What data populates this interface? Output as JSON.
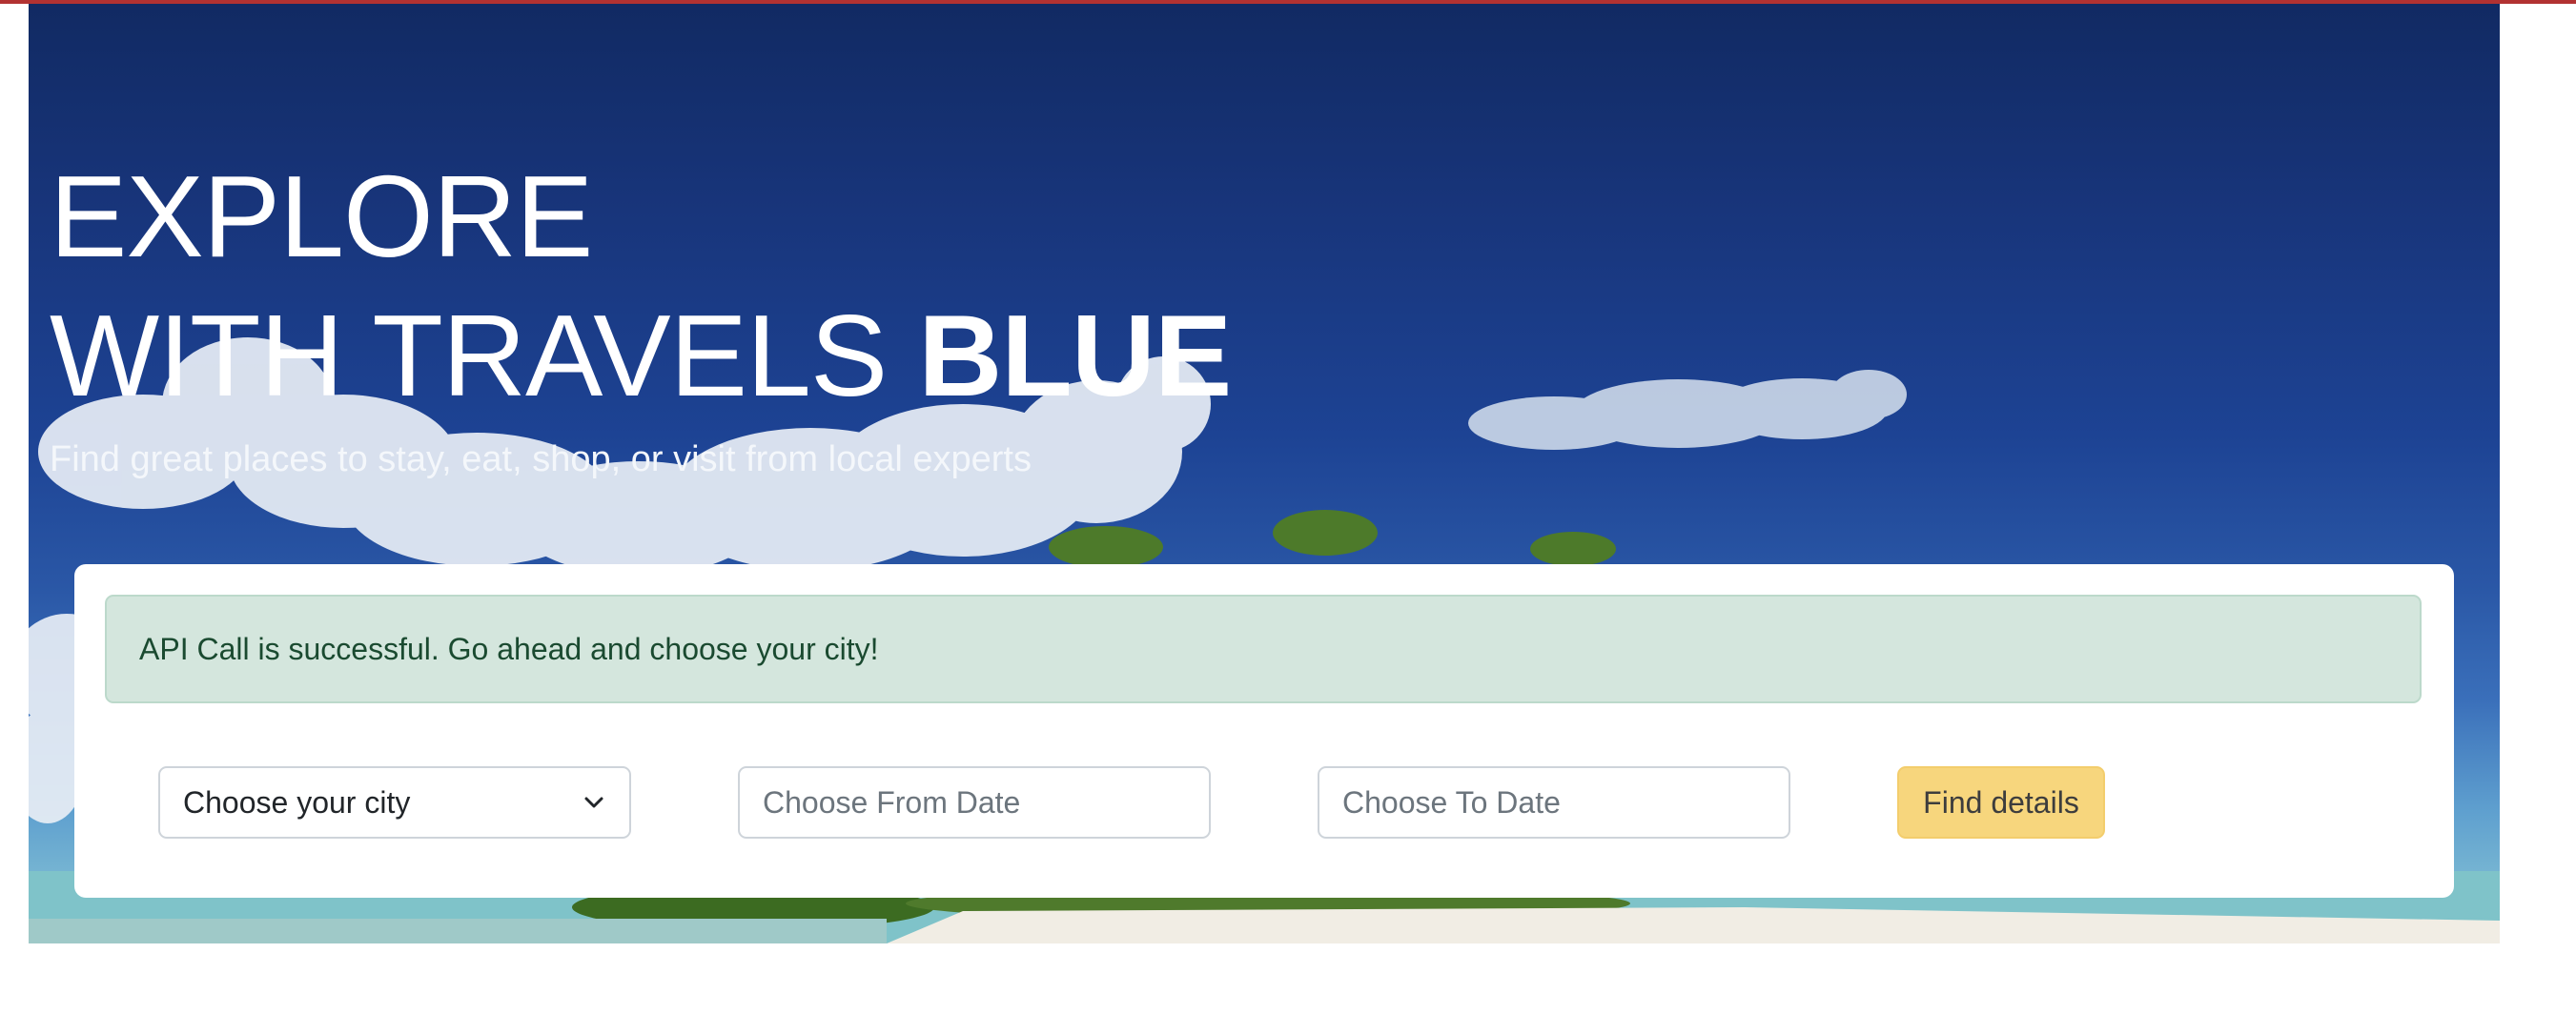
{
  "hero": {
    "title_line1": "EXPLORE",
    "title_line2_prefix": "WITH TRAVELS ",
    "title_line2_brand": "BLUE",
    "subtitle": "Find great places to stay, eat, shop, or visit from local experts"
  },
  "alert": {
    "message": "API Call is successful. Go ahead and choose your city!"
  },
  "search": {
    "city_select_value": "Choose your city",
    "from_date_placeholder": "Choose From Date",
    "to_date_placeholder": "Choose To Date",
    "submit_label": "Find details"
  },
  "colors": {
    "top_bar": "#b23232",
    "alert_bg": "#d4e6dd",
    "alert_text": "#1a4a30",
    "button_bg": "#f7d67d"
  },
  "icons": {
    "select_chevron": "chevron-down-icon"
  }
}
